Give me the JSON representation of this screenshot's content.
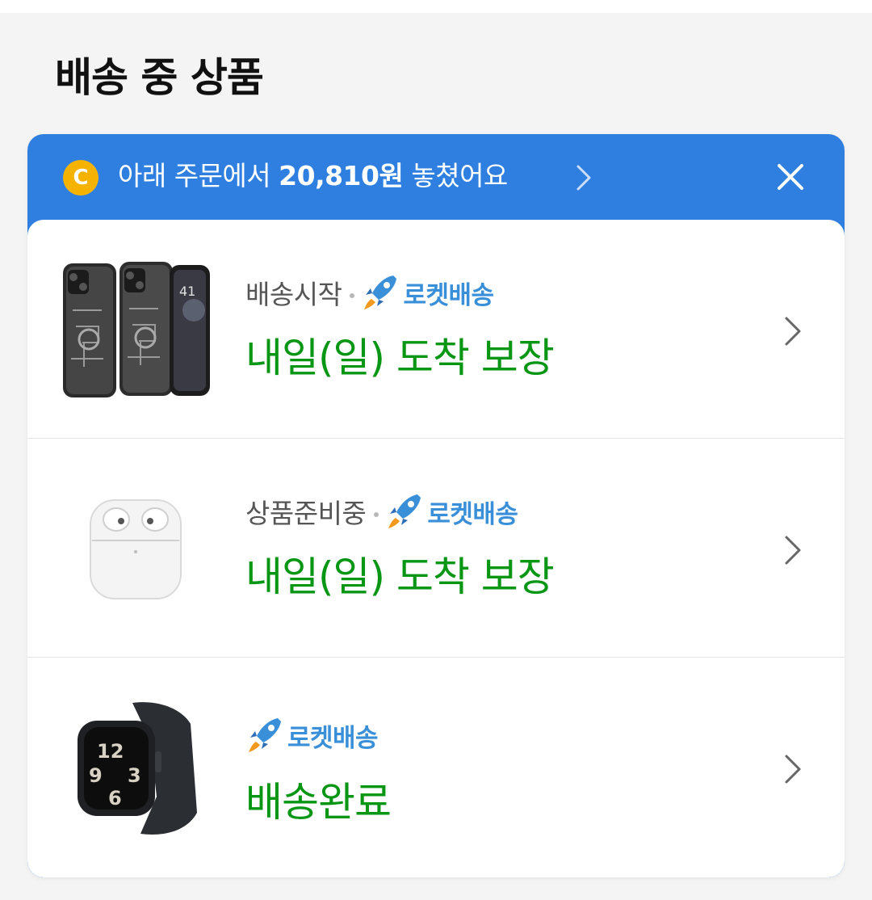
{
  "section": {
    "title": "배송 중 상품"
  },
  "banner": {
    "coin_symbol": "C",
    "text_before": "아래 주문에서 ",
    "amount": "20,810원",
    "text_after": " 놓쳤어요",
    "color": "#2f7fe0",
    "coin_color": "#f5b300"
  },
  "orders": [
    {
      "product": "phone cases",
      "status": "배송시작",
      "delivery_type": "로켓배송",
      "arrival": "내일(일) 도착 보장"
    },
    {
      "product": "earbuds",
      "status": "상품준비중",
      "delivery_type": "로켓배송",
      "arrival": "내일(일) 도착 보장"
    },
    {
      "product": "smartwatch",
      "delivery_type": "로켓배송",
      "arrival": "배송완료"
    }
  ],
  "colors": {
    "arrival_green": "#0a9615",
    "rocket_blue": "#3a8fd9",
    "status_gray": "#555555"
  }
}
